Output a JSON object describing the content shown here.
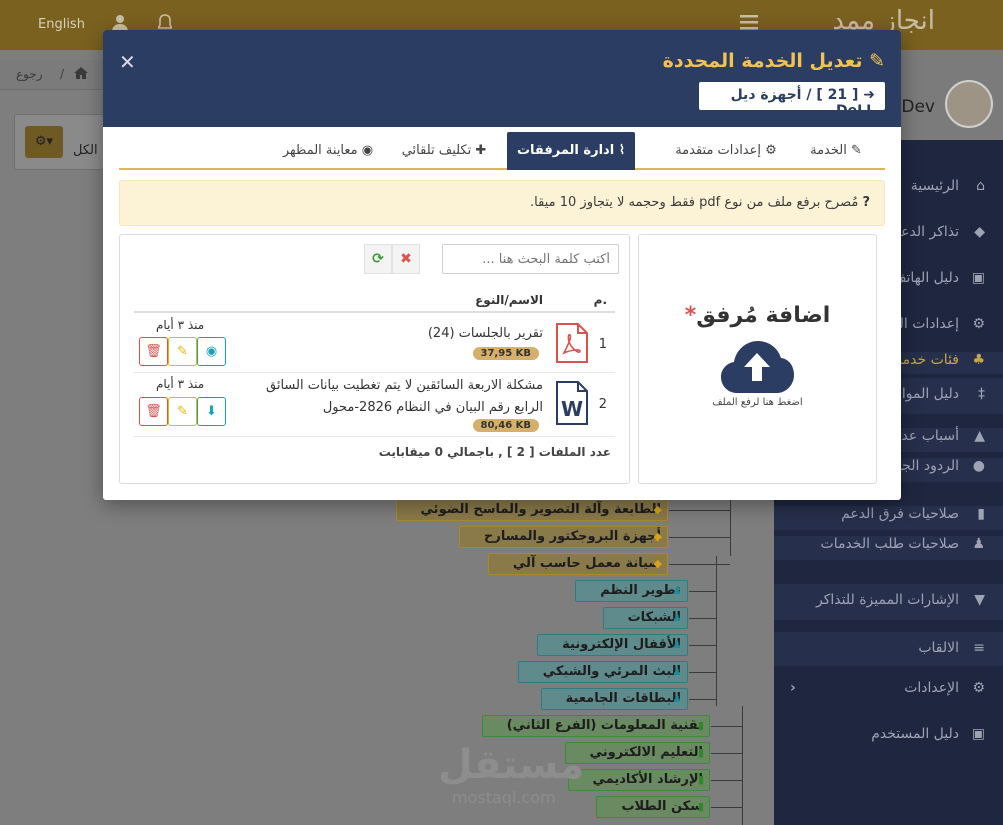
{
  "topbar": {
    "language": "English",
    "brand": "انجاز ممد"
  },
  "breadcrumb": {
    "back": "رجوع"
  },
  "toolbar": {
    "all_label": "الكل"
  },
  "user": {
    "name": "Dev"
  },
  "sidebar": {
    "items": [
      {
        "label": "الرئيسية"
      },
      {
        "label": "تذاكر الدعم"
      },
      {
        "label": "دليل الهاتف"
      },
      {
        "label": "إعدادات الدعم"
      },
      {
        "label": "فئات خدمات"
      },
      {
        "label": "دليل المواقع"
      },
      {
        "label": "أسباب عدم"
      },
      {
        "label": "الردود الجاهزة"
      },
      {
        "label": "صلاحيات فرق الدعم"
      },
      {
        "label": "صلاحيات طلب الخدمات"
      },
      {
        "label": "الإشارات المميزة للتذاكر"
      },
      {
        "label": "الالقاب"
      },
      {
        "label": "الإعدادات"
      },
      {
        "label": "دليل المستخدم"
      }
    ]
  },
  "tree": [
    {
      "label": "الطابعة وآلة التصوير والماسح الضوئي",
      "color": "gold"
    },
    {
      "label": "أجهزة البروجكتور والمسارح",
      "color": "gold"
    },
    {
      "label": "صيانة معمل حاسب آلي",
      "color": "gold"
    },
    {
      "label": "تطوير النظم",
      "color": "teal"
    },
    {
      "label": "الشبكات",
      "color": "teal"
    },
    {
      "label": "الأقفال الإلكترونية",
      "color": "teal"
    },
    {
      "label": "البث المرئي والشبكي",
      "color": "teal"
    },
    {
      "label": "البطاقات الجامعية",
      "color": "teal"
    },
    {
      "label": "تقنية المعلومات (الفرع الثاني)",
      "color": "green"
    },
    {
      "label": "التعليم الالكتروني",
      "color": "green"
    },
    {
      "label": "الإرشاد الأكاديمي",
      "color": "green"
    },
    {
      "label": "سكن الطلاب",
      "color": "green"
    }
  ],
  "watermark": {
    "arabic": "مستقل",
    "latin": "mostaql.com"
  },
  "modal": {
    "title": "تعديل الخدمة المحددة",
    "subtitle": "[ 21 ] / أجهزة ديل DeLL",
    "tabs": [
      {
        "label": "الخدمة",
        "icon": "edit-icon"
      },
      {
        "label": "إعدادات متقدمة",
        "icon": "cogs-icon"
      },
      {
        "label": "ادارة المرفقات",
        "icon": "paperclip-icon",
        "active": true
      },
      {
        "label": "تكليف تلقائي",
        "icon": "user-plus-icon"
      },
      {
        "label": "معاينة المظهر",
        "icon": "eye-icon"
      }
    ],
    "notice": "مُصرح برفع ملف من نوع pdf فقط وحجمه لا يتجاوز 10 ميقا.",
    "upload": {
      "title": "اضافة مُرفق",
      "required_mark": "*",
      "hint": "اضغط هنا لرفع الملف"
    },
    "search": {
      "placeholder": "أكتب كلمة البحث هنا ..."
    },
    "table": {
      "col_num": "م.",
      "col_name": "الاسم/النوع",
      "rows": [
        {
          "num": "1",
          "type": "pdf",
          "name": "تقرير بالجلسات (24)",
          "size": "37,95 KB",
          "ago": "منذ ٣ أيام",
          "actions": [
            "view",
            "edit",
            "delete"
          ]
        },
        {
          "num": "2",
          "type": "word",
          "name": "مشكلة الاربعة السائقين لا يتم تغطيت بيانات السائق الرابع رقم البيان في النظام 2826-محول",
          "size": "80,46 KB",
          "ago": "منذ ٣ أيام",
          "actions": [
            "download",
            "edit",
            "delete"
          ]
        }
      ],
      "summary": "عدد الملفات [ 2 ] , باجمالي 0 ميقابايت"
    },
    "colors": {
      "header": "#2c3d63",
      "title": "#f3c24f",
      "accent": "#e0b45a",
      "danger": "#d9534f",
      "warning": "#e5b800",
      "info": "#17a2b8"
    }
  }
}
